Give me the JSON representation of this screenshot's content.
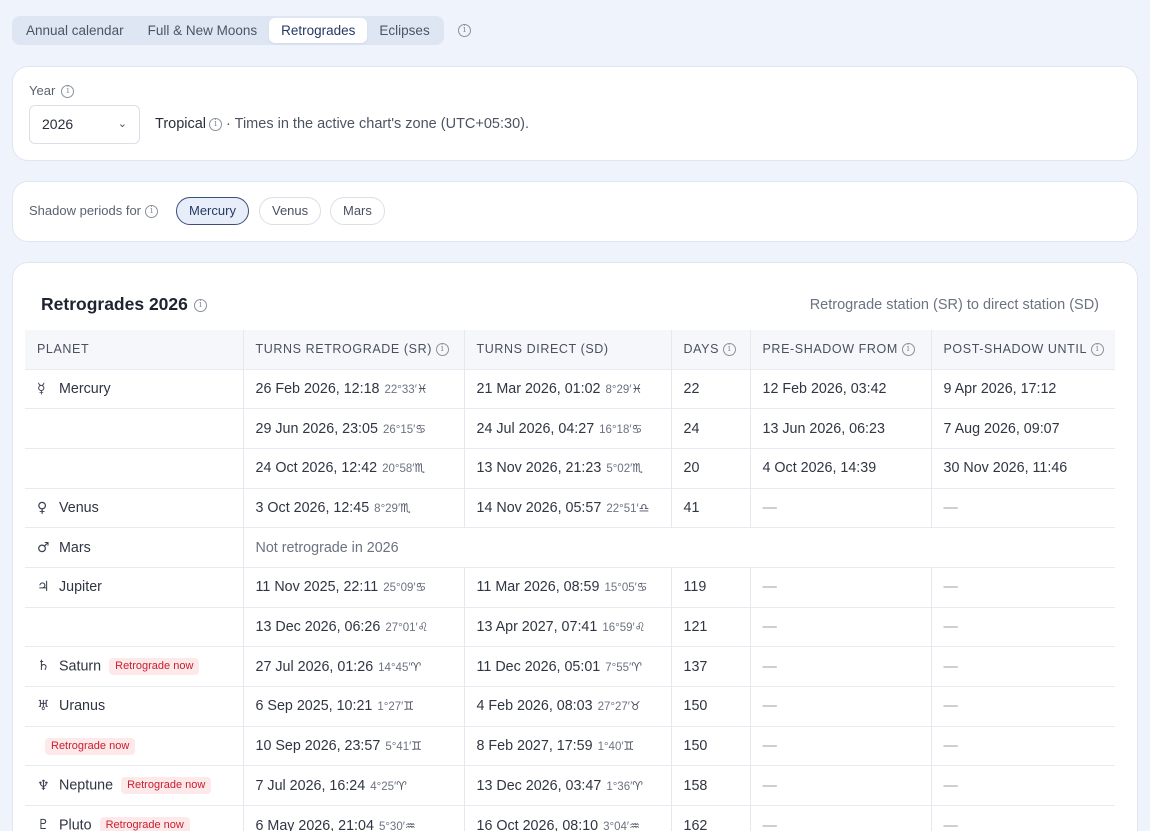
{
  "tabs": [
    {
      "label": "Annual calendar"
    },
    {
      "label": "Full & New Moons"
    },
    {
      "label": "Retrogrades"
    },
    {
      "label": "Eclipses"
    }
  ],
  "year_card": {
    "label": "Year",
    "selected_year": "2026",
    "zodiac": "Tropical",
    "zone_note": "· Times in the active chart's zone (UTC+05:30)."
  },
  "shadow_card": {
    "label": "Shadow periods for",
    "pills": [
      "Mercury",
      "Venus",
      "Mars"
    ],
    "active": "Mercury"
  },
  "table_card": {
    "title": "Retrogrades 2026",
    "subtitle": "Retrograde station (SR) to direct station (SD)",
    "headers": [
      "PLANET",
      "TURNS RETROGRADE (SR)",
      "TURNS DIRECT (SD)",
      "DAYS",
      "PRE-SHADOW FROM",
      "POST-SHADOW UNTIL"
    ],
    "retro_now_label": "Retrograde now",
    "dash": "—",
    "rows": [
      {
        "glyph": "☿",
        "planet": "Mercury",
        "sr": "26 Feb 2026, 12:18",
        "sr_deg": "22°33′",
        "sr_sign": "♓",
        "sd": "21 Mar 2026, 01:02",
        "sd_deg": "8°29′",
        "sd_sign": "♓",
        "days": "22",
        "pre": "12 Feb 2026, 03:42",
        "post": "9 Apr 2026, 17:12"
      },
      {
        "glyph": "",
        "planet": "",
        "sr": "29 Jun 2026, 23:05",
        "sr_deg": "26°15′",
        "sr_sign": "♋",
        "sd": "24 Jul 2026, 04:27",
        "sd_deg": "16°18′",
        "sd_sign": "♋",
        "days": "24",
        "pre": "13 Jun 2026, 06:23",
        "post": "7 Aug 2026, 09:07"
      },
      {
        "glyph": "",
        "planet": "",
        "sr": "24 Oct 2026, 12:42",
        "sr_deg": "20°58′",
        "sr_sign": "♏",
        "sd": "13 Nov 2026, 21:23",
        "sd_deg": "5°02′",
        "sd_sign": "♏",
        "days": "20",
        "pre": "4 Oct 2026, 14:39",
        "post": "30 Nov 2026, 11:46"
      },
      {
        "glyph": "♀",
        "planet": "Venus",
        "sr": "3 Oct 2026, 12:45",
        "sr_deg": "8°29′",
        "sr_sign": "♏",
        "sd": "14 Nov 2026, 05:57",
        "sd_deg": "22°51′",
        "sd_sign": "♎",
        "days": "41",
        "pre": "—",
        "post": "—"
      },
      {
        "glyph": "♂",
        "planet": "Mars",
        "not_retro": "Not retrograde in 2026"
      },
      {
        "glyph": "♃",
        "planet": "Jupiter",
        "sr": "11 Nov 2025, 22:11",
        "sr_deg": "25°09′",
        "sr_sign": "♋",
        "sd": "11 Mar 2026, 08:59",
        "sd_deg": "15°05′",
        "sd_sign": "♋",
        "days": "119",
        "pre": "—",
        "post": "—"
      },
      {
        "glyph": "",
        "planet": "",
        "sr": "13 Dec 2026, 06:26",
        "sr_deg": "27°01′",
        "sr_sign": "♌",
        "sd": "13 Apr 2027, 07:41",
        "sd_deg": "16°59′",
        "sd_sign": "♌",
        "days": "121",
        "pre": "—",
        "post": "—"
      },
      {
        "glyph": "♄",
        "planet": "Saturn",
        "retro_now": true,
        "sr": "27 Jul 2026, 01:26",
        "sr_deg": "14°45′",
        "sr_sign": "♈",
        "sd": "11 Dec 2026, 05:01",
        "sd_deg": "7°55′",
        "sd_sign": "♈",
        "days": "137",
        "pre": "—",
        "post": "—"
      },
      {
        "glyph": "♅",
        "planet": "Uranus",
        "sr": "6 Sep 2025, 10:21",
        "sr_deg": "1°27′",
        "sr_sign": "♊",
        "sd": "4 Feb 2026, 08:03",
        "sd_deg": "27°27′",
        "sd_sign": "♉",
        "days": "150",
        "pre": "—",
        "post": "—"
      },
      {
        "glyph": "",
        "planet": "",
        "retro_now": true,
        "sr": "10 Sep 2026, 23:57",
        "sr_deg": "5°41′",
        "sr_sign": "♊",
        "sd": "8 Feb 2027, 17:59",
        "sd_deg": "1°40′",
        "sd_sign": "♊",
        "days": "150",
        "pre": "—",
        "post": "—"
      },
      {
        "glyph": "♆",
        "planet": "Neptune",
        "retro_now": true,
        "sr": "7 Jul 2026, 16:24",
        "sr_deg": "4°25′",
        "sr_sign": "♈",
        "sd": "13 Dec 2026, 03:47",
        "sd_deg": "1°36′",
        "sd_sign": "♈",
        "days": "158",
        "pre": "—",
        "post": "—"
      },
      {
        "glyph": "♇",
        "planet": "Pluto",
        "retro_now": true,
        "sr": "6 May 2026, 21:04",
        "sr_deg": "5°30′",
        "sr_sign": "♒",
        "sd": "16 Oct 2026, 08:10",
        "sd_deg": "3°04′",
        "sd_sign": "♒",
        "days": "162",
        "pre": "—",
        "post": "—"
      }
    ]
  }
}
